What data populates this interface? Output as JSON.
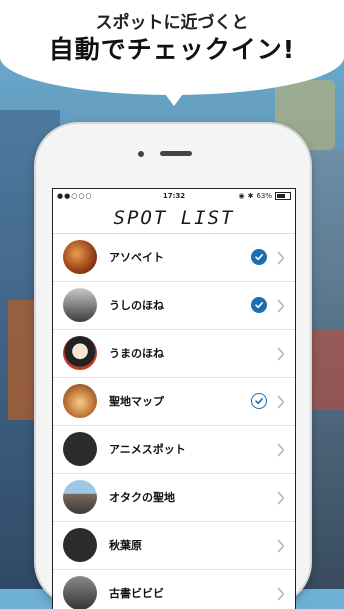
{
  "banner": {
    "subtitle": "スポットに近づくと",
    "headline": "自動でチェックイン!"
  },
  "status_bar": {
    "carrier": "●●○○○",
    "time": "17:32",
    "battery": "63%"
  },
  "nav": {
    "title": "SPOT LIST"
  },
  "spots": [
    {
      "name": "アソベイト",
      "checked": "filled"
    },
    {
      "name": "うしのほね",
      "checked": "filled"
    },
    {
      "name": "うまのほね",
      "checked": "none"
    },
    {
      "name": "聖地マップ",
      "checked": "outline"
    },
    {
      "name": "アニメスポット",
      "checked": "none"
    },
    {
      "name": "オタクの聖地",
      "checked": "none"
    },
    {
      "name": "秋葉原",
      "checked": "none"
    },
    {
      "name": "古書ビビビ",
      "checked": "none"
    }
  ],
  "colors": {
    "check_blue": "#1a6fb3",
    "chevron_gray": "#b5b5b5"
  },
  "icons": {
    "check": "check-icon",
    "chevron": "chevron-right-icon"
  }
}
